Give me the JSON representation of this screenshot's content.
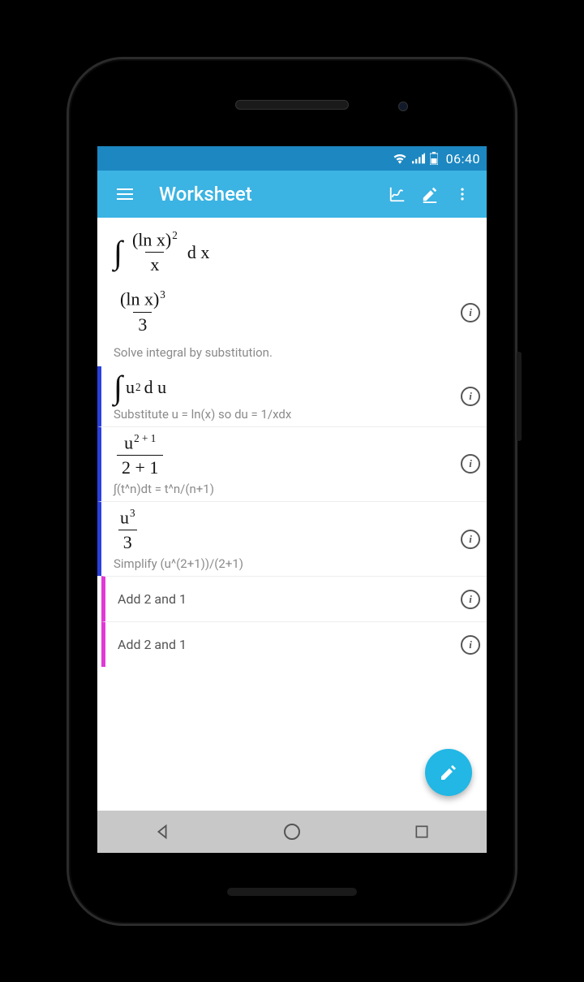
{
  "status": {
    "time": "06:40"
  },
  "appbar": {
    "title": "Worksheet"
  },
  "problem": {
    "input_display": "∫ (ln x)² / x dx",
    "result_display": "(ln x)³ / 3"
  },
  "steps": [
    {
      "caption": "Solve integral by substitution."
    },
    {
      "math": "∫ u² du",
      "caption": "Substitute u = ln(x) so du = 1/xdx"
    },
    {
      "math": "u^(2+1) / (2+1)",
      "caption": "∫(t^n)dt = t^n/(n+1)"
    },
    {
      "math": "u³ / 3",
      "caption": "Simplify (u^(2+1))/(2+1)"
    },
    {
      "text": "Add 2 and 1"
    },
    {
      "text": "Add 2 and 1"
    }
  ],
  "info_label": "i"
}
